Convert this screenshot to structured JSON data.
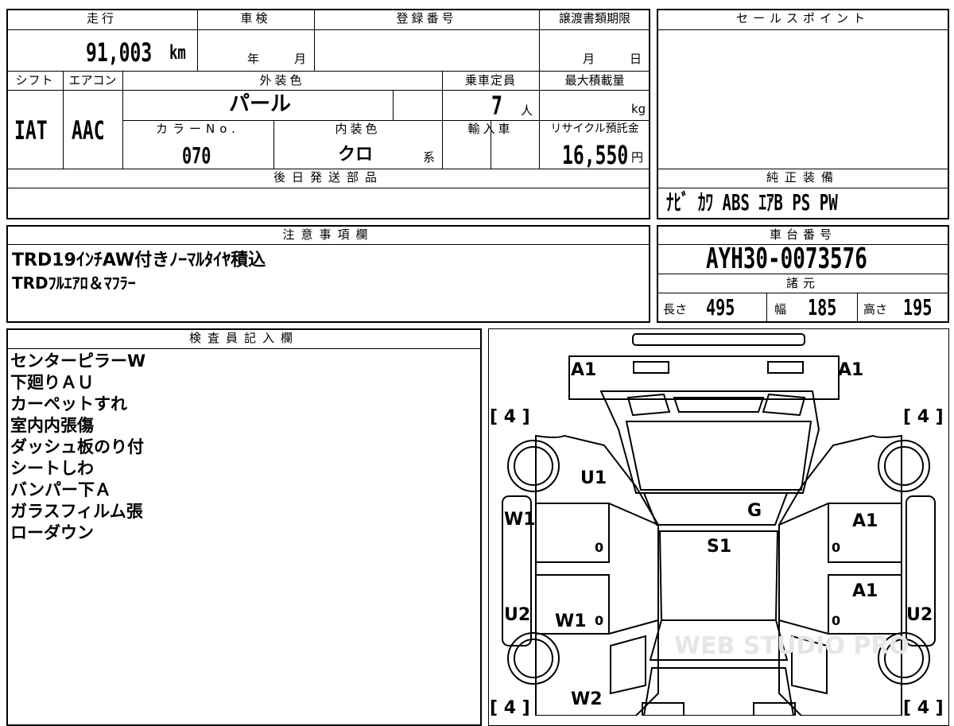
{
  "top_table": {
    "mileage": {
      "label": "走行",
      "value": "91,003",
      "unit": "km"
    },
    "inspection": {
      "label": "車検",
      "year_unit": "年",
      "month_unit": "月"
    },
    "registration": {
      "label": "登録番号"
    },
    "transfer_deadline": {
      "label": "譲渡書類期限",
      "month_unit": "月",
      "day_unit": "日"
    },
    "shift": {
      "label": "シフト",
      "value": "IAT"
    },
    "aircon": {
      "label": "エアコン",
      "value": "AAC"
    },
    "exterior_color": {
      "label": "外装色",
      "value": "パール"
    },
    "capacity": {
      "label": "乗車定員",
      "value": "7",
      "unit": "人"
    },
    "max_load": {
      "label": "最大積載量",
      "unit": "kg"
    },
    "color_no": {
      "label": "カラーNo.",
      "value": "070"
    },
    "interior_color": {
      "label": "内装色",
      "value": "クロ",
      "suffix": "系"
    },
    "import": {
      "label": "輸入車"
    },
    "recycle_fee": {
      "label": "リサイクル預託金",
      "value": "16,550",
      "unit": "円"
    },
    "later_parts": {
      "label": "後日発送部品"
    }
  },
  "sales_point": {
    "label": "セールスポイント"
  },
  "genuine_equipment": {
    "label": "純正装備",
    "value": "ﾅﾋﾞ ｶﾜ ABS ｴｱB PS PW"
  },
  "notes": {
    "label": "注意事項欄",
    "lines": [
      "TRD19ｲﾝﾁAW付きﾉｰﾏﾙﾀｲﾔ積込",
      "TRDﾌﾙｴｱﾛ＆ﾏﾌﾗｰ"
    ]
  },
  "chassis": {
    "label": "車台番号",
    "value": "AYH30-0073576"
  },
  "specs": {
    "label": "諸元",
    "length": {
      "label": "長さ",
      "value": "495"
    },
    "width": {
      "label": "幅",
      "value": "185"
    },
    "height": {
      "label": "高さ",
      "value": "195"
    }
  },
  "inspector": {
    "label": "検査員記入欄",
    "lines": [
      "センターピラーW",
      "下廻りＡＵ",
      "カーペットすれ",
      "室内内張傷",
      "ダッシュ板のり付",
      "シートしわ",
      "バンパー下Ａ",
      "ガラスフィルム張",
      "ローダウン"
    ]
  },
  "diagram": {
    "marks": {
      "a1_front_left": "A1",
      "a1_front_right": "A1",
      "tire_fl": "[ 4 ]",
      "tire_fr": "[ 4 ]",
      "u1": "U1",
      "g": "G",
      "w1_left": "W1",
      "a1_right_front_door": "A1",
      "s1": "S1",
      "zero_1": "0",
      "zero_2": "0",
      "a1_right_rear_door": "A1",
      "u2_left": "U2",
      "w1_rear": "W1",
      "zero_3": "0",
      "zero_4": "0",
      "u2_right": "U2",
      "w2": "W2",
      "tire_rl": "[ 4 ]",
      "tire_rr": "[ 4 ]"
    },
    "watermark": "WEB STUDIO PRO"
  }
}
